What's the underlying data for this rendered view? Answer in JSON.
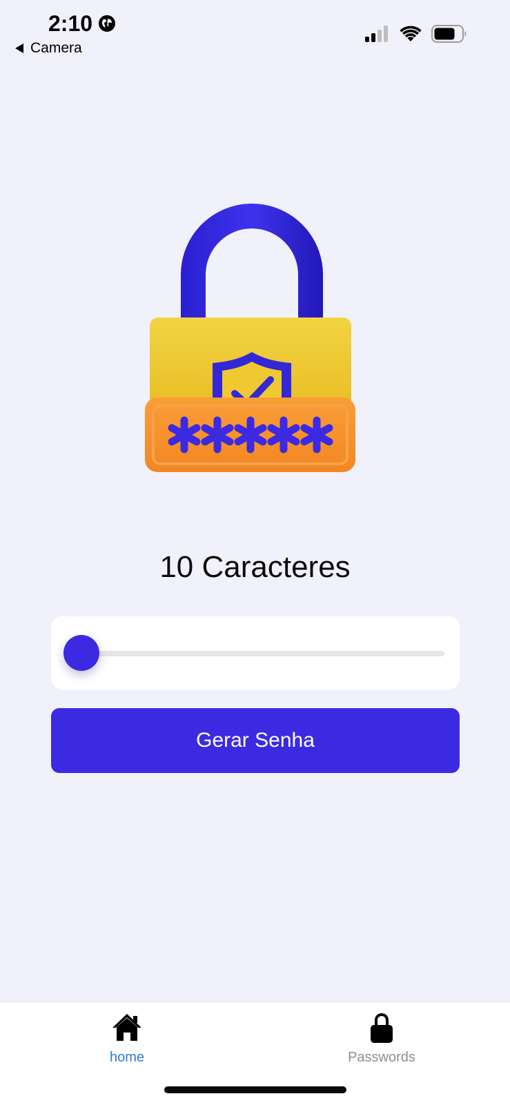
{
  "status_bar": {
    "time": "2:10",
    "back_label": "Camera",
    "icons": [
      "globe-icon",
      "cellular-signal-icon",
      "wifi-icon",
      "battery-icon"
    ]
  },
  "illustration": {
    "name": "padlock-password-illustration",
    "colors": {
      "shackle": "#2F23D9",
      "body": "#F0C930",
      "plate": "#F7922E",
      "asterisks": "#3C2AE3"
    }
  },
  "main": {
    "length_label": "10 Caracteres",
    "slider": {
      "value_fraction": 0.0
    },
    "generate_button_label": "Gerar Senha"
  },
  "tab_bar": {
    "tabs": [
      {
        "label": "home",
        "icon": "home-icon",
        "active": true
      },
      {
        "label": "Passwords",
        "icon": "lock-icon",
        "active": false
      }
    ]
  },
  "colors": {
    "background": "#F1F1FB",
    "accent": "#3C2AE3",
    "active_tab": "#2F79D6",
    "inactive_tab": "#8E8E93"
  }
}
